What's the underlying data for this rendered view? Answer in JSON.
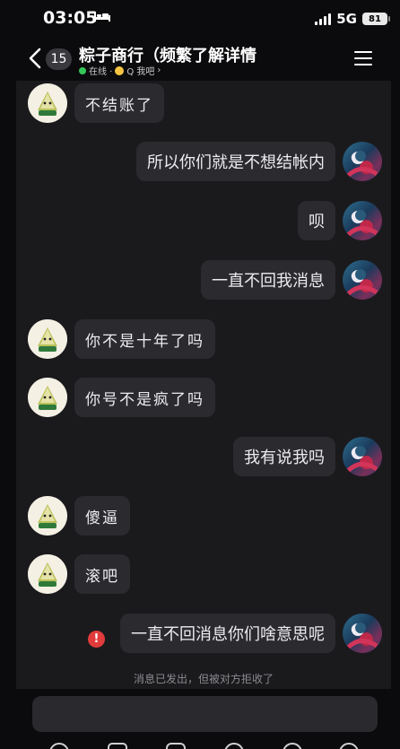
{
  "status": {
    "time": "03:05",
    "network": "5G",
    "battery": "81"
  },
  "header": {
    "unread_count": "15",
    "title": "粽子商行（频繁了解详情",
    "online": "在线 ·",
    "qzone": "Q 我吧",
    "arrow": "›"
  },
  "messages": [
    {
      "side": "left",
      "text": "不结账了"
    },
    {
      "side": "right",
      "text": "所以你们就是不想结帐内"
    },
    {
      "side": "right",
      "text": "呗"
    },
    {
      "side": "right",
      "text": "一直不回我消息"
    },
    {
      "side": "left",
      "text": "你不是十年了吗"
    },
    {
      "side": "left",
      "text": "你号不是疯了吗"
    },
    {
      "side": "right",
      "text": "我有说我吗"
    },
    {
      "side": "left",
      "text": "傻逼"
    },
    {
      "side": "left",
      "text": "滚吧"
    },
    {
      "side": "right",
      "text": "一直不回消息你们啥意思呢"
    }
  ],
  "failed_icon": "!",
  "system_notice": "消息已发出，但被对方拒收了",
  "avatar_left_label": "粽子商行",
  "icons": [
    "back-chevron-icon",
    "menu-icon",
    "moon-icon",
    "error-icon"
  ]
}
